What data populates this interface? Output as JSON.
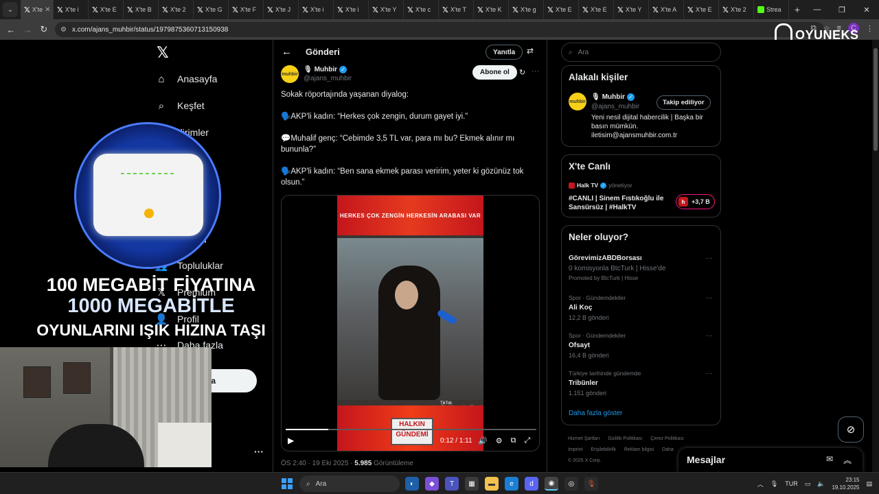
{
  "browser": {
    "tabs": [
      {
        "label": "X'te ",
        "active": true
      },
      {
        "label": "X'te i"
      },
      {
        "label": "X'te E"
      },
      {
        "label": "X'te B"
      },
      {
        "label": "X'te 2"
      },
      {
        "label": "X'te G"
      },
      {
        "label": "X'te F"
      },
      {
        "label": "X'te J"
      },
      {
        "label": "X'te i"
      },
      {
        "label": "X'te i"
      },
      {
        "label": "X'te Y"
      },
      {
        "label": "X'te c"
      },
      {
        "label": "X'te T"
      },
      {
        "label": "X'te K"
      },
      {
        "label": "X'te g"
      },
      {
        "label": "X'te E"
      },
      {
        "label": "X'te E"
      },
      {
        "label": "X'te Y"
      },
      {
        "label": "X'te A"
      },
      {
        "label": "X'te E"
      },
      {
        "label": "X'te 2"
      },
      {
        "label": "Strea"
      }
    ],
    "url": "x.com/ajans_muhbir/status/1979875360713150938",
    "profile_initial": "C"
  },
  "watermark": "OYUNEKS",
  "nav": {
    "items": [
      {
        "label": "Anasayfa",
        "icon": "home-icon"
      },
      {
        "label": "Keşfet",
        "icon": "search-icon"
      },
      {
        "label": "dirimler",
        "icon": "bell-icon"
      },
      {
        "label": "aretleri",
        "icon": "bookmark-icon"
      },
      {
        "label": "Topluluklar",
        "icon": "communities-icon"
      },
      {
        "label": "Premium",
        "icon": "x-icon"
      },
      {
        "label": "Profil",
        "icon": "person-icon"
      },
      {
        "label": "Daha fazla",
        "icon": "more-circle-icon"
      }
    ],
    "post_button": "ayınla"
  },
  "post": {
    "header_title": "Gönderi",
    "reply_label": "Yanıtla",
    "author_name": "Muhbir",
    "author_handle": "@ajans_muhbir",
    "avatar_text": "muhbir",
    "follow_label": "Abone ol",
    "text": {
      "intro": "Sokak röportajında yaşanan diyalog:",
      "line1": "🗣️AKP'li kadın: “Herkes çok zengin, durum gayet iyi.”",
      "line2": "💬Muhalif genç: “Cebimde 3,5 TL var, para mı bu? Ekmek alınır mı bununla?”",
      "line3": "🗣️AKP'li kadın: “Ben sana ekmek parası veririm, yeter ki gözünüz tok olsun.”"
    },
    "video": {
      "banner_top": "HERKES ÇOK ZENGİN HERKESİN ARABASI VAR",
      "tiktok": "TikTok @halkingundemi0",
      "banner_bottom": "HALKIN GÜNDEMİ",
      "time": "0:12 / 1:11",
      "progress": 0.17
    },
    "meta_time": "ÖS 2:40 · 19 Eki 2025 · ",
    "views": "5.985",
    "views_label": " Görüntüleme"
  },
  "right": {
    "search_placeholder": "Ara",
    "relevant": {
      "title": "Alakalı kişiler",
      "name": "Muhbir",
      "handle": "@ajans_muhbir",
      "follow_label": "Takip ediliyor",
      "bio": "Yeni nesil dijital habercilik | Başka bir basın mümkün. iletisim@ajansmuhbir.com.tr"
    },
    "live": {
      "title": "X'te Canlı",
      "host": "Halk TV",
      "host_suffix": "yönetiyor",
      "stream_title": "#CANLI | Sinem Fıstıkoğlu ile Sansürsüz | #HalkTV",
      "listeners": "+3,7 B"
    },
    "trends": {
      "title": "Neler oluyor?",
      "items": [
        {
          "ctx": "",
          "name": "GörevimizABDBorsası",
          "count": "0 komisyonla BtcTurk | Hisse'de",
          "extra": "Promoted by BtcTurk | Hisse"
        },
        {
          "ctx": "Spor · Gündemdekiler",
          "name": "Ali Koç",
          "count": "12,2 B gönderi"
        },
        {
          "ctx": "Spor · Gündemdekiler",
          "name": "Ofsayt",
          "count": "16,4 B gönderi"
        },
        {
          "ctx": "Türkiye tarihinde gündemde",
          "name": "Tribünler",
          "count": "1.151 gönderi"
        }
      ],
      "show_more": "Daha fazla göster"
    },
    "footer": [
      "Hizmet Şartları",
      "Gizlilik Politikası",
      "Çerez Politikası",
      "Imprint",
      "Erişilebilirlik",
      "Reklam bilgisi",
      "Daha",
      "© 2025 X Corp."
    ]
  },
  "messages": {
    "title": "Mesajlar"
  },
  "ad": {
    "line1": "100 MEGABİT FİYATINA",
    "line2": "1000 MEGABİTLE",
    "line3": "OYUNLARINI IŞIK HIZINA TAŞI"
  },
  "taskbar": {
    "search": "Ara",
    "lang": "TUR",
    "time": "23:15",
    "date": "19.10.2025"
  }
}
